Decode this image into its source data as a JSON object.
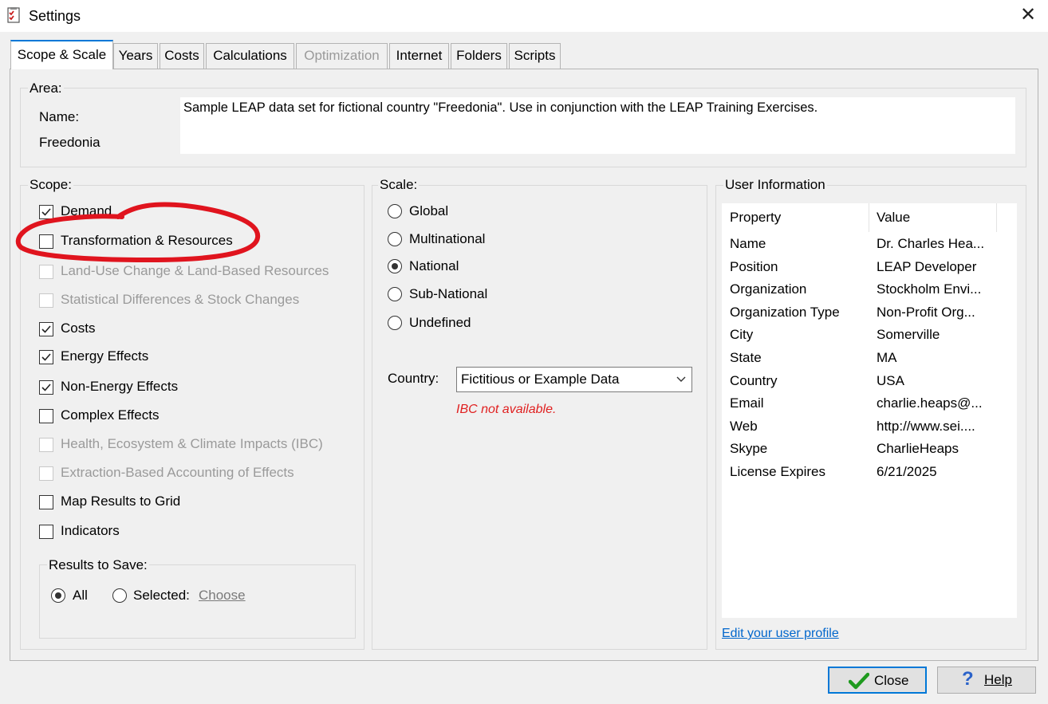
{
  "window": {
    "title": "Settings",
    "icon": "settings-app-icon",
    "close_icon": "close-icon"
  },
  "tabs": [
    {
      "label": "Scope & Scale",
      "active": true
    },
    {
      "label": "Years"
    },
    {
      "label": "Costs"
    },
    {
      "label": "Calculations"
    },
    {
      "label": "Optimization",
      "disabled": true
    },
    {
      "label": "Internet"
    },
    {
      "label": "Folders"
    },
    {
      "label": "Scripts"
    }
  ],
  "area": {
    "label": "Area:",
    "name_label": "Name:",
    "name_value": "Freedonia",
    "description": "Sample LEAP data set for fictional country \"Freedonia\". Use in conjunction with the LEAP Training Exercises."
  },
  "scope": {
    "label": "Scope:",
    "items": [
      {
        "label": "Demand",
        "checked": true
      },
      {
        "label": "Transformation & Resources",
        "checked": false
      },
      {
        "label": "Land-Use Change & Land-Based Resources",
        "checked": false,
        "disabled": true
      },
      {
        "label": "Statistical Differences & Stock Changes",
        "checked": false,
        "disabled": true
      },
      {
        "label": "Costs",
        "checked": true
      },
      {
        "label": "Energy Effects",
        "checked": true
      },
      {
        "label": "Non-Energy Effects",
        "checked": true
      },
      {
        "label": "Complex Effects",
        "checked": false
      },
      {
        "label": "Health, Ecosystem & Climate Impacts (IBC)",
        "checked": false,
        "disabled": true
      },
      {
        "label": "Extraction-Based Accounting of Effects",
        "checked": false,
        "disabled": true
      },
      {
        "label": "Map Results to Grid",
        "checked": false
      },
      {
        "label": "Indicators",
        "checked": false
      }
    ],
    "results_to_save": {
      "label": "Results to Save:",
      "all_label": "All",
      "selected_label": "Selected:",
      "choose_label": "Choose",
      "selected_option": "All"
    }
  },
  "scale": {
    "label": "Scale:",
    "options": [
      "Global",
      "Multinational",
      "National",
      "Sub-National",
      "Undefined"
    ],
    "selected": "National",
    "country_label": "Country:",
    "country_value": "Fictitious or Example Data",
    "ibc_message": "IBC not available.",
    "ibc_color": "#e02020"
  },
  "user_information": {
    "label": "User Information",
    "columns": [
      "Property",
      "Value"
    ],
    "rows": [
      [
        "Name",
        "Dr. Charles Hea..."
      ],
      [
        "Position",
        "LEAP Developer"
      ],
      [
        "Organization",
        "Stockholm Envi..."
      ],
      [
        "Organization Type",
        "Non-Profit Org..."
      ],
      [
        "City",
        "Somerville"
      ],
      [
        "State",
        "MA"
      ],
      [
        "Country",
        "USA"
      ],
      [
        "Email",
        "charlie.heaps@..."
      ],
      [
        "Web",
        "http://www.sei...."
      ],
      [
        "Skype",
        "CharlieHeaps"
      ],
      [
        "License Expires",
        "6/21/2025"
      ]
    ],
    "edit_link": "Edit your user profile"
  },
  "buttons": {
    "close": "Close",
    "help": "Help",
    "close_icon": "checkmark-icon",
    "help_icon": "question-icon"
  },
  "annotation": {
    "shape": "red-hand-drawn-ellipse",
    "color": "#e0141e"
  }
}
